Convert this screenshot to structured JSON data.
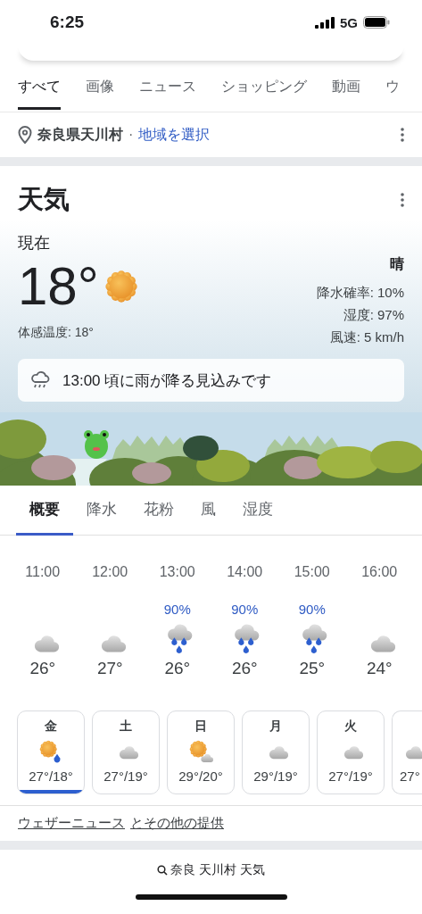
{
  "status_bar": {
    "time": "6:25",
    "network": "5G"
  },
  "search_tabs": [
    {
      "label": "すべて",
      "selected": true
    },
    {
      "label": "画像",
      "selected": false
    },
    {
      "label": "ニュース",
      "selected": false
    },
    {
      "label": "ショッピング",
      "selected": false
    },
    {
      "label": "動画",
      "selected": false
    },
    {
      "label": "ウ",
      "selected": false
    }
  ],
  "location": {
    "place": "奈良県天川村",
    "separator": "·",
    "link": "地域を選択"
  },
  "weather": {
    "title": "天気",
    "current_label": "現在",
    "temperature": "18°",
    "kind": "sun",
    "condition": "晴",
    "feels_like": "体感温度: 18°",
    "details": [
      "降水確率: 10%",
      "湿度: 97%",
      "風速: 5 km/h"
    ],
    "alert": "13:00 頃に雨が降る見込みです",
    "tabs": [
      {
        "label": "概要",
        "selected": true
      },
      {
        "label": "降水",
        "selected": false
      },
      {
        "label": "花粉",
        "selected": false
      },
      {
        "label": "風",
        "selected": false
      },
      {
        "label": "湿度",
        "selected": false
      }
    ],
    "hourly": [
      {
        "time": "11:00",
        "kind": "cloud",
        "temp": "26°"
      },
      {
        "time": "12:00",
        "kind": "cloud",
        "temp": "27°"
      },
      {
        "time": "13:00",
        "precip": "90%",
        "kind": "rain",
        "temp": "26°"
      },
      {
        "time": "14:00",
        "precip": "90%",
        "kind": "rain",
        "temp": "26°"
      },
      {
        "time": "15:00",
        "precip": "90%",
        "kind": "rain",
        "temp": "25°"
      },
      {
        "time": "16:00",
        "kind": "cloud",
        "temp": "24°"
      }
    ],
    "daily": [
      {
        "day": "金",
        "kind": "sun_rain",
        "temps": "27°/18°",
        "selected": true
      },
      {
        "day": "土",
        "kind": "cloud",
        "temps": "27°/19°",
        "selected": false
      },
      {
        "day": "日",
        "kind": "sun_cloud",
        "temps": "29°/20°",
        "selected": false
      },
      {
        "day": "月",
        "kind": "cloud",
        "temps": "29°/19°",
        "selected": false
      },
      {
        "day": "火",
        "kind": "cloud",
        "temps": "27°/19°",
        "selected": false
      },
      {
        "kind": "cloud",
        "temps": "27°",
        "selected": false
      }
    ],
    "attribution": {
      "source": "ウェザーニュース",
      "suffix": "とその他の提供"
    }
  },
  "bottom_bar": {
    "query": "奈良 天川村 天気"
  }
}
